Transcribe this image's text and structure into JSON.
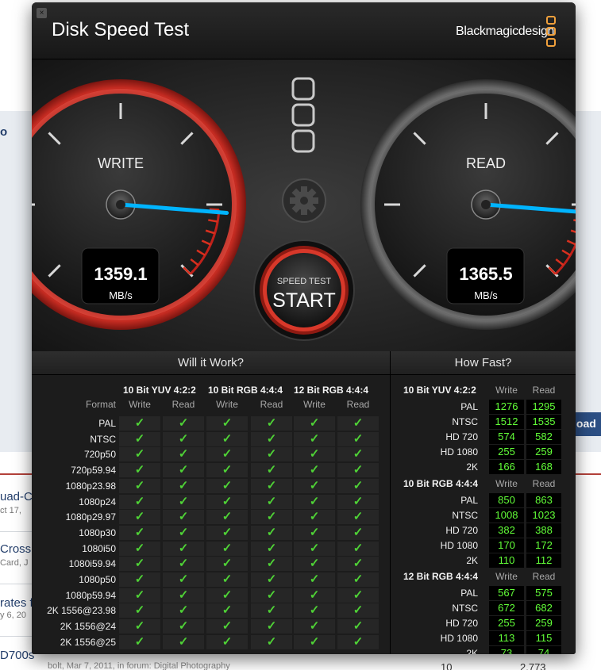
{
  "window": {
    "title": "Disk Speed Test",
    "brand": "Blackmagicdesign",
    "close_glyph": "×"
  },
  "gauges": {
    "write": {
      "label": "WRITE",
      "value": "1359.1",
      "unit": "MB/s",
      "needle_fraction": 0.85
    },
    "read": {
      "label": "READ",
      "value": "1365.5",
      "unit": "MB/s",
      "needle_fraction": 0.85
    }
  },
  "start_button": {
    "top_label": "SPEED TEST",
    "label": "START"
  },
  "settings_icon": "gear-icon",
  "will_it_work": {
    "heading": "Will it Work?",
    "format_header": "Format",
    "groups": [
      "10 Bit YUV 4:2:2",
      "10 Bit RGB 4:4:4",
      "12 Bit RGB 4:4:4"
    ],
    "write_label": "Write",
    "read_label": "Read",
    "check_glyph": "✓",
    "formats": [
      "PAL",
      "NTSC",
      "720p50",
      "720p59.94",
      "1080p23.98",
      "1080p24",
      "1080p29.97",
      "1080p30",
      "1080i50",
      "1080i59.94",
      "1080p50",
      "1080p59.94",
      "2K 1556@23.98",
      "2K 1556@24",
      "2K 1556@25"
    ]
  },
  "how_fast": {
    "heading": "How Fast?",
    "write_label": "Write",
    "read_label": "Read",
    "groups": [
      {
        "name": "10 Bit YUV 4:2:2",
        "rows": [
          {
            "format": "PAL",
            "write": "1276",
            "read": "1295"
          },
          {
            "format": "NTSC",
            "write": "1512",
            "read": "1535"
          },
          {
            "format": "HD 720",
            "write": "574",
            "read": "582"
          },
          {
            "format": "HD 1080",
            "write": "255",
            "read": "259"
          },
          {
            "format": "2K",
            "write": "166",
            "read": "168"
          }
        ]
      },
      {
        "name": "10 Bit RGB 4:4:4",
        "rows": [
          {
            "format": "PAL",
            "write": "850",
            "read": "863"
          },
          {
            "format": "NTSC",
            "write": "1008",
            "read": "1023"
          },
          {
            "format": "HD 720",
            "write": "382",
            "read": "388"
          },
          {
            "format": "HD 1080",
            "write": "170",
            "read": "172"
          },
          {
            "format": "2K",
            "write": "110",
            "read": "112"
          }
        ]
      },
      {
        "name": "12 Bit RGB 4:4:4",
        "rows": [
          {
            "format": "PAL",
            "write": "567",
            "read": "575"
          },
          {
            "format": "NTSC",
            "write": "672",
            "read": "682"
          },
          {
            "format": "HD 720",
            "write": "255",
            "read": "259"
          },
          {
            "format": "HD 1080",
            "write": "113",
            "read": "115"
          },
          {
            "format": "2K",
            "write": "73",
            "read": "74"
          }
        ]
      }
    ]
  },
  "background": {
    "items": [
      {
        "title": "uad-C",
        "sub": "ct 17,"
      },
      {
        "title": "Cross",
        "sub": "Card, J"
      },
      {
        "title": "rates f",
        "sub": "y 6, 20"
      },
      {
        "title": "D700s",
        "sub": ""
      }
    ],
    "edge_letter": "o",
    "right_button": "load",
    "footer": "bolt, Mar 7, 2011, in forum: Digital Photography",
    "footer_num_1": "10",
    "footer_num_2": "2,773"
  },
  "colors": {
    "accent_red": "#c0211a",
    "needle_blue": "#00b4ff",
    "value_green": "#62ff38",
    "check_green": "#4fd336",
    "brand_orange": "#f0a03c"
  }
}
